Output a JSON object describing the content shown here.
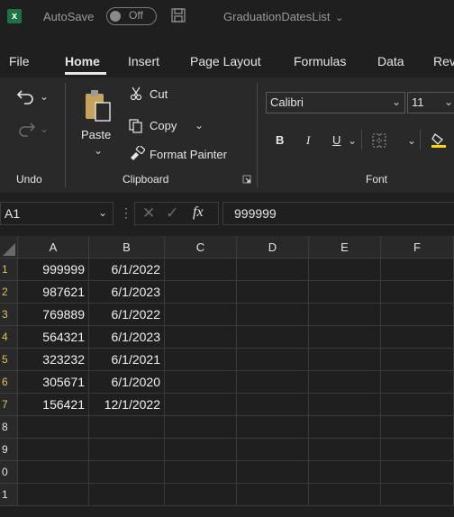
{
  "titlebar": {
    "app_icon": "excel-icon",
    "logo_text": "x",
    "autosave_label": "AutoSave",
    "autosave_state": "Off",
    "save_icon": "save-icon",
    "doc_title": "GraduationDatesList",
    "doc_title_chevron": "⌄"
  },
  "tabs": [
    "File",
    "Home",
    "Insert",
    "Page Layout",
    "Formulas",
    "Data",
    "Rev"
  ],
  "active_tab": "Home",
  "ribbon": {
    "undo_group": "Undo",
    "clipboard_group": "Clipboard",
    "font_group": "Font",
    "paste_label": "Paste",
    "cut_label": "Cut",
    "copy_label": "Copy",
    "format_painter_label": "Format Painter",
    "font_name": "Calibri",
    "font_size": "11",
    "bold": "B",
    "italic": "I",
    "underline": "U"
  },
  "formula_bar": {
    "name_box": "A1",
    "fx_label": "fx",
    "content": "999999"
  },
  "grid": {
    "columns": [
      "A",
      "B",
      "C",
      "D",
      "E",
      "F"
    ],
    "row_numbers": [
      "1",
      "2",
      "3",
      "4",
      "5",
      "6",
      "7",
      "8",
      "9",
      "0",
      "1"
    ],
    "rows": [
      [
        "999999",
        "6/1/2022"
      ],
      [
        "987621",
        "6/1/2023"
      ],
      [
        "769889",
        "6/1/2022"
      ],
      [
        "564321",
        "6/1/2023"
      ],
      [
        "323232",
        "6/1/2021"
      ],
      [
        "305671",
        "6/1/2020"
      ],
      [
        "156421",
        "12/1/2022"
      ],
      [
        "",
        ""
      ],
      [
        "",
        ""
      ],
      [
        "",
        ""
      ],
      [
        "",
        ""
      ]
    ]
  },
  "colors": {
    "accent": "#1e7145",
    "background": "#1f1f1f",
    "ribbon": "#292929",
    "row_header_highlight": "#e0c060"
  }
}
